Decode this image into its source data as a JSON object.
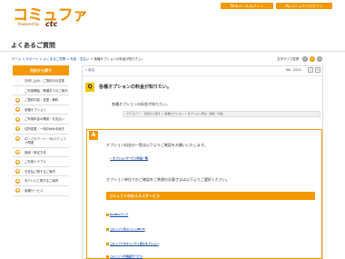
{
  "header": {
    "logo_text": "コミュファ",
    "logo_sub": "Powered by",
    "logo_brand": "ctc",
    "btn_web_mail": "Webメールログイン",
    "btn_my_commufa": "Myコミュファログイン"
  },
  "page_title": "よくあるご質問",
  "breadcrumb": {
    "links": "ホーム > サポート > よくあるご質問 > 料金・支払い >",
    "current": "各種オプションの料金が知りたい。"
  },
  "font_size": {
    "label": "文字サイズ変更",
    "small": "小",
    "medium": "中",
    "large": "大"
  },
  "sidebar": {
    "heading": "目的から探す",
    "items": [
      {
        "label": "お申し込み／ご契約中の変更",
        "bullet": "›"
      },
      {
        "label": "ご利用開始・開通までのご案内",
        "bullet": "›"
      },
      {
        "label": "ご契約内容・変更・解約",
        "bullet": "●"
      },
      {
        "label": "各種オプション",
        "bullet": "●"
      },
      {
        "label": "ご利用料金の確認・お支払い",
        "bullet": "●"
      },
      {
        "label": "住所変更／一時お休み手続き",
        "bullet": "●"
      },
      {
        "label": "ID・パスワード・Myコミュファ関連",
        "bullet": "●"
      },
      {
        "label": "接続・設定方法",
        "bullet": "●"
      },
      {
        "label": "ご利用トラブル",
        "bullet": "●"
      },
      {
        "label": "お支払に関するご案内",
        "bullet": "●"
      },
      {
        "label": "光テレビに関するご案内",
        "bullet": "●"
      },
      {
        "label": "各種サービス",
        "bullet": "●"
      }
    ]
  },
  "main": {
    "back_label": "« 戻る",
    "question_no": "No : 2221",
    "tool_icons": [
      "print-icon",
      "mail-icon"
    ],
    "q_badge": "Q",
    "question": "各種オプションの料金が知りたい。",
    "question_sub": "各種オプションの料金が知りたい。",
    "category": "カテゴリー ： 目的から探す > 各種オプション > オプション申込・解約・料金",
    "a_badge": "A",
    "answer_1": "オプション料金の一覧は以下よりご確認をお願いいたします。",
    "answer_link": "» オプションサービス料金一覧",
    "answer_2": "オプション単位でのご確認をご希望のお客さまは以下よりご選択ください。",
    "service_heading": "コミュファのおススメサービス",
    "services": [
      "Netflixパック",
      "コミュファ光メッシュWi-Fi",
      "コミュファセキュリティ安心オプション",
      "コミュファ光電話サービス"
    ]
  }
}
